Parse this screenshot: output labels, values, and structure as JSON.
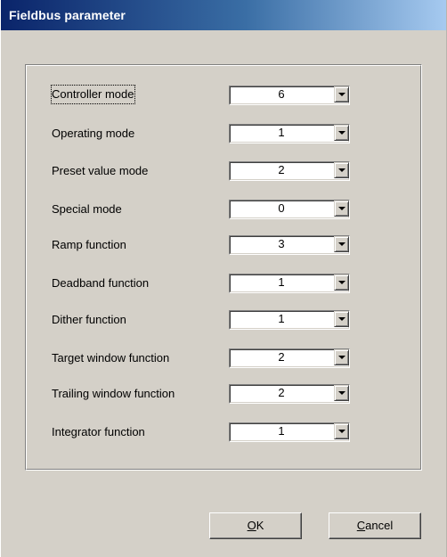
{
  "window": {
    "title": "Fieldbus parameter"
  },
  "parameters": [
    {
      "label": "Controller mode",
      "value": "6"
    },
    {
      "label": "Operating mode",
      "value": "1"
    },
    {
      "label": "Preset value mode",
      "value": "2"
    },
    {
      "label": "Special mode",
      "value": "0"
    },
    {
      "label": "Ramp function",
      "value": "3"
    },
    {
      "label": "Deadband function",
      "value": "1"
    },
    {
      "label": "Dither function",
      "value": "1"
    },
    {
      "label": "Target window function",
      "value": "2"
    },
    {
      "label": "Trailing window function",
      "value": "2"
    },
    {
      "label": "Integrator function",
      "value": "1"
    }
  ],
  "buttons": {
    "ok": {
      "mnemonic": "O",
      "rest": "K"
    },
    "cancel": {
      "mnemonic": "C",
      "rest": "ancel"
    }
  },
  "colors": {
    "titlebar_start": "#0a246a",
    "titlebar_end": "#a6caf0",
    "face": "#d4d0c8"
  }
}
